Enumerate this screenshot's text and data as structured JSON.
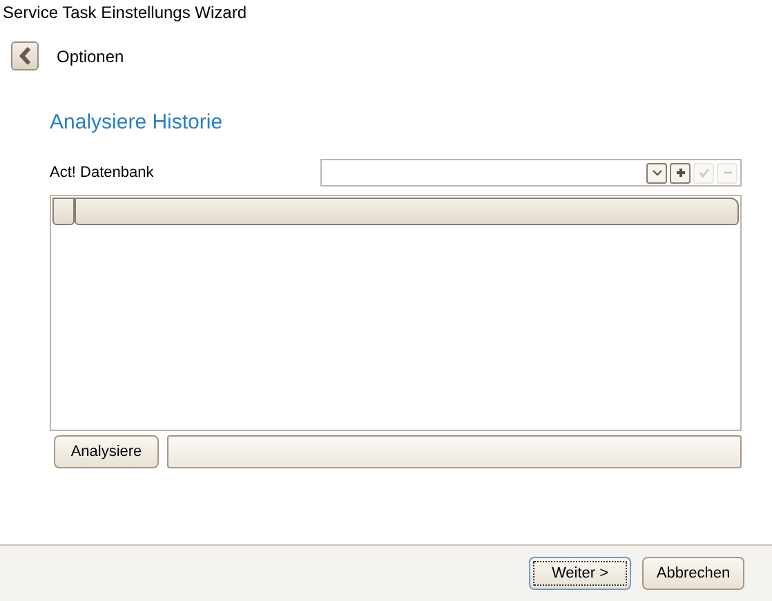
{
  "window": {
    "title": "Service Task Einstellungs Wizard"
  },
  "header": {
    "title": "Optionen"
  },
  "section_title": "Analysiere Historie",
  "database": {
    "label": "Act! Datenbank",
    "tools": [
      {
        "kind": "dropdown",
        "disabled": false
      },
      {
        "kind": "add",
        "disabled": false
      },
      {
        "kind": "confirm",
        "disabled": true
      },
      {
        "kind": "remove",
        "disabled": true
      }
    ]
  },
  "grid": {
    "columns": [
      {
        "kind": "indicator"
      },
      {
        "kind": "data"
      }
    ]
  },
  "analyze": {
    "button": "Analysiere",
    "progress": {
      "level": 0
    }
  },
  "footer": {
    "buttons": [
      {
        "label": "Weiter >",
        "default": true
      },
      {
        "label": "Abbrechen",
        "default": false
      }
    ]
  }
}
